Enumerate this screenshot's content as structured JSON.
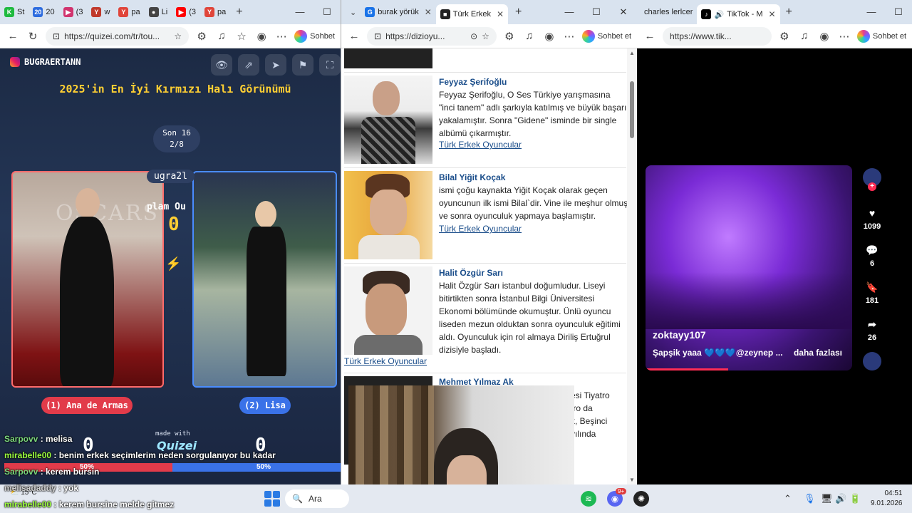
{
  "left_window": {
    "tabs": [
      {
        "label": "St",
        "color": "#1fba3f",
        "glyph": "K"
      },
      {
        "label": "20",
        "color": "#2d6cdf",
        "glyph": "20"
      },
      {
        "label": "(3",
        "color": "#d1346e",
        "glyph": "▶"
      },
      {
        "label": "w",
        "color": "#c0392b",
        "glyph": "Y"
      },
      {
        "label": "pa",
        "color": "#e0453a",
        "glyph": "Y"
      },
      {
        "label": "Li",
        "color": "#444444",
        "glyph": "●"
      },
      {
        "label": "(3",
        "color": "#ff0000",
        "glyph": "▶"
      },
      {
        "label": "pa",
        "color": "#e0453a",
        "glyph": "Y"
      }
    ],
    "new_tab": "+",
    "url": "https://quizei.com/tr/tou...",
    "chat_label": "Sohbet"
  },
  "quiz": {
    "instagram_handle": "BUGRAERTANN",
    "title": "2025'in En İyi Kırmızı Halı Görünümü",
    "round_label": "Son 16",
    "round_progress": "2/8",
    "overlay_user": "ugra2l",
    "overlay_total": "plam Ou",
    "overlay_total_value": "0",
    "vs": "⚡",
    "candidate1": {
      "label": "(1) Ana de Armas",
      "score": "0",
      "percent": "50%"
    },
    "candidate2": {
      "label": "(2) Lisa",
      "score": "0",
      "percent": "50%"
    },
    "made_with": "made with",
    "brand": "Quizei",
    "backdrop_text": "OSCARS"
  },
  "chat": [
    {
      "user": "Sarpovv",
      "user_color": "#7dd87d",
      "message": " : melisa"
    },
    {
      "user": "mirabelle00",
      "user_color": "#9cff3f",
      "message": " : benim erkek seçimlerim neden sorgulanıyor bu kadar"
    },
    {
      "user": "Sarpovv",
      "user_color": "#7dd87d",
      "message": " : kerem bursin"
    },
    {
      "user": "melisadaddy",
      "user_color": "#d0d0d0",
      "message": " : yok"
    },
    {
      "user": "mirabelle00",
      "user_color": "#9cff3f",
      "message": " : kerem bursine melde gitmez"
    }
  ],
  "middle_window": {
    "tabs": [
      {
        "label": "burak yörük",
        "color": "#1a73e8",
        "glyph": "G"
      },
      {
        "label": "Türk Erkek",
        "color": "#222222",
        "glyph": "■"
      }
    ],
    "new_tab": "+",
    "url": "https://dizioyu...",
    "chat_label": "Sohbet et"
  },
  "actors": [
    {
      "name": "Feyyaz Şerifoğlu",
      "desc": "Feyyaz Şerifoğlu, O Ses Türkiye yarışmasına \"inci tanem\" adlı şarkıyla katılmış ve büyük başarı yakalamıştır. Sonra \"Gidene\" isminde bir single albümü çıkarmıştır.",
      "link": "Türk Erkek Oyuncular"
    },
    {
      "name": "Bilal Yiğit Koçak",
      "desc": "ismi çoğu kaynakta Yiğit Koçak olarak geçen oyuncunun ilk ismi Bilal`dir. Vine ile meşhur olmuş ve sonra oyunculuk yapmaya başlamıştır.",
      "link": "Türk Erkek Oyuncular"
    },
    {
      "name": "Halit Özgür Sarı",
      "desc": "Halit Özgür Sarı istanbul doğumludur. Liseyi bitirtikten sonra İstanbul Bilgi Üniversitesi Ekonomi bölümünde okumuştur. Ünlü oyuncu liseden mezun olduktan sonra oyunculuk eğitimi aldı. Oyunculuk için rol almaya Diriliş Ertuğrul dizisiyle başladı.",
      "link": "Türk Erkek Oyuncular"
    },
    {
      "name": "Mehmet Yılmaz Ak",
      "desc_lines": [
        "esi Tiyatro",
        "tro da",
        "k, Beşinci",
        "yılında"
      ]
    }
  ],
  "right_window": {
    "tabs": [
      {
        "label": "charles lerlcer",
        "color": "#1a73e8",
        "glyph": ""
      },
      {
        "label": "TikTok - M",
        "color": "#000000",
        "glyph": "♪"
      }
    ],
    "new_tab": "+",
    "url": "https://www.tik...",
    "chat_label": "Sohbet et"
  },
  "tiktok": {
    "username": "zoktayy107",
    "caption": "Şapşik yaaa 💙💙💙@zeynep ...",
    "more": "daha fazlası",
    "likes": "1099",
    "comments": "6",
    "saves": "181",
    "shares": "26"
  },
  "taskbar": {
    "weather": "15°C",
    "search_label": "Ara",
    "time": "04:51",
    "date": "9.01.2026",
    "discord_badge": "9+"
  }
}
